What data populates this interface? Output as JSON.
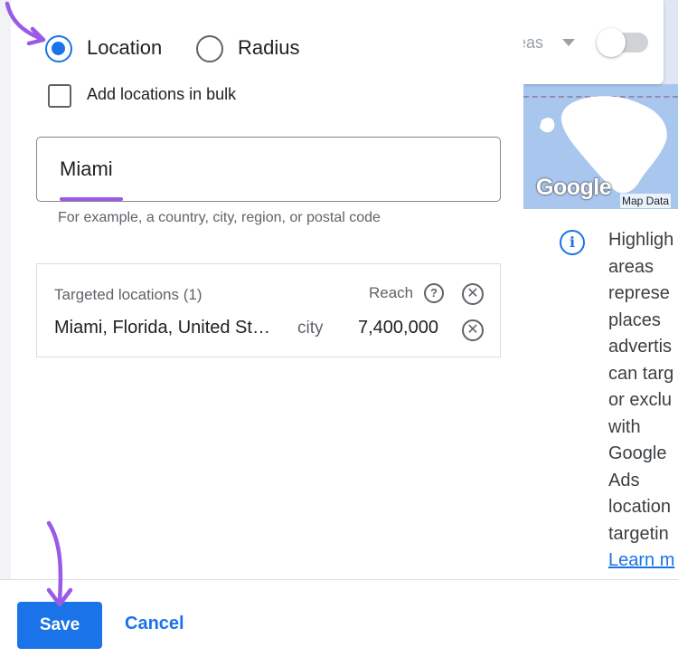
{
  "location_options": {
    "location_label": "Location",
    "radius_label": "Radius",
    "selected": "Location"
  },
  "bulk": {
    "label": "Add locations in bulk",
    "checked": false
  },
  "search": {
    "value": "Miami",
    "helper": "For example, a country, city, region, or postal code"
  },
  "targeted": {
    "title": "Targeted locations (1)",
    "reach_label": "Reach",
    "help_icon": "help-circle-icon",
    "remove_icon": "close-circle-icon",
    "rows": [
      {
        "name": "Miami, Florida, United St…",
        "type": "city",
        "reach": "7,400,000"
      }
    ]
  },
  "map_panel": {
    "areas_text": "eas",
    "caret_icon": "caret-down-icon",
    "toggle_on": false,
    "google_logo": "Google",
    "map_data": "Map Data",
    "info_icon": "info-icon",
    "info_lines": [
      "Highligh",
      "areas",
      "represe",
      "places",
      "advertis",
      "can targ",
      "or exclu",
      "with",
      "Google",
      "Ads",
      "location",
      "targetin"
    ],
    "learn_more": "Learn m"
  },
  "footer": {
    "save_label": "Save",
    "cancel_label": "Cancel"
  },
  "colors": {
    "accent": "#1a73e8",
    "annotation": "#9b59e8",
    "map_water": "#a9c6ef",
    "land": "#ffffff"
  }
}
